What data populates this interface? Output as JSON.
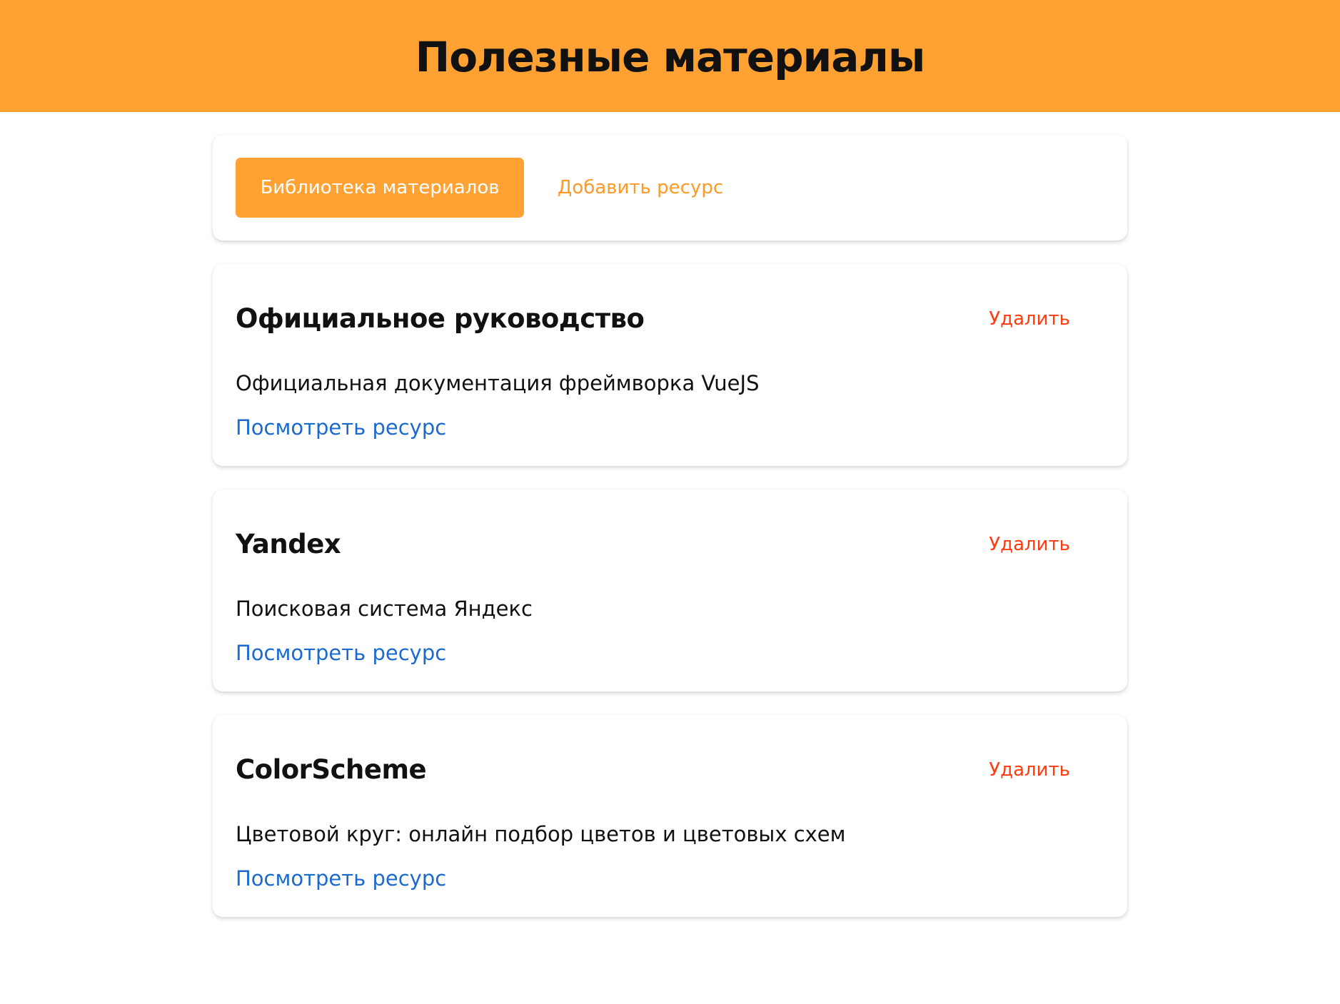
{
  "header": {
    "title": "Полезные материалы"
  },
  "nav": {
    "library_label": "Библиотека материалов",
    "add_label": "Добавить ресурс"
  },
  "resources": [
    {
      "title": "Официальное руководство",
      "description": "Официальная документация фреймворка VueJS",
      "link_label": "Посмотреть ресурс",
      "delete_label": "Удалить"
    },
    {
      "title": "Yandex",
      "description": "Поисковая система Яндекс",
      "link_label": "Посмотреть ресурс",
      "delete_label": "Удалить"
    },
    {
      "title": "ColorScheme",
      "description": "Цветовой круг: онлайн подбор цветов и цветовых схем",
      "link_label": "Посмотреть ресурс",
      "delete_label": "Удалить"
    }
  ],
  "colors": {
    "accent": "#ffa233",
    "delete": "#ff3b12",
    "link": "#1b6ad0"
  }
}
